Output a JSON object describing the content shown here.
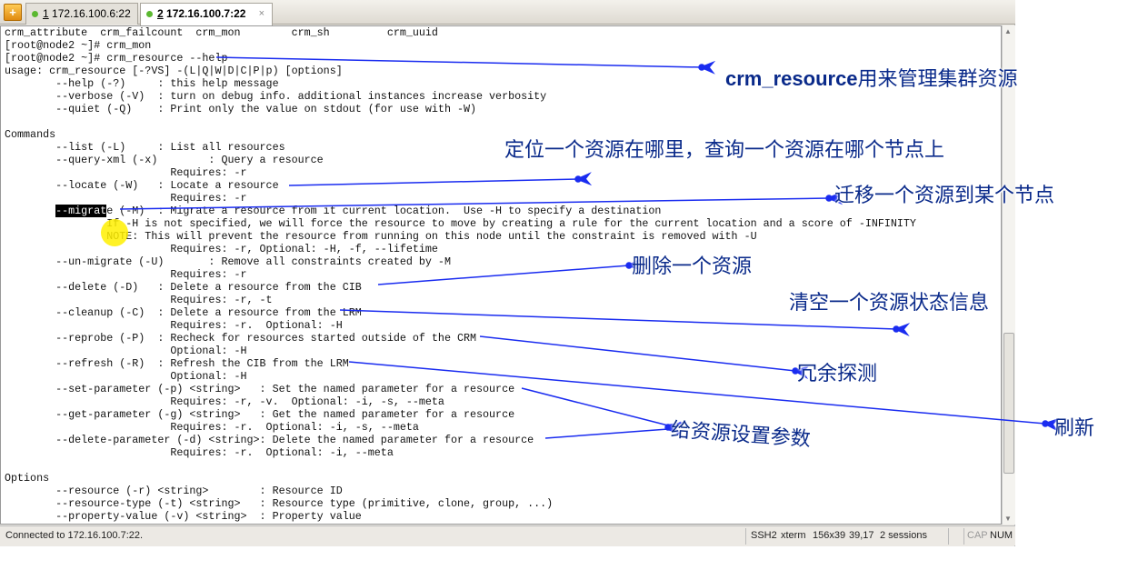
{
  "tabs": [
    {
      "num": "1",
      "label": " 172.16.100.6:22",
      "active": false
    },
    {
      "num": "2",
      "label": " 172.16.100.7:22",
      "active": true
    }
  ],
  "new_tab_icon": "+",
  "close_glyph": "×",
  "terminal": {
    "lines": [
      "crm_attribute  crm_failcount  crm_mon        crm_sh         crm_uuid",
      "[root@node2 ~]# crm_mon",
      "[root@node2 ~]# crm_resource --help",
      "usage: crm_resource [-?VS] -(L|Q|W|D|C|P|p) [options]",
      "        --help (-?)     : this help message",
      "        --verbose (-V)  : turn on debug info. additional instances increase verbosity",
      "        --quiet (-Q)    : Print only the value on stdout (for use with -W)",
      "",
      "Commands",
      "        --list (-L)     : List all resources",
      "        --query-xml (-x)        : Query a resource",
      "                          Requires: -r",
      "        --locate (-W)   : Locate a resource",
      "                          Requires: -r",
      "        --migrate (-M)  : Migrate a resource from it current location.  Use -H to specify a destination",
      "                If -H is not specified, we will force the resource to move by creating a rule for the current location and a score of -INFINITY",
      "                NOTE: This will prevent the resource from running on this node until the constraint is removed with -U",
      "                          Requires: -r, Optional: -H, -f, --lifetime",
      "        --un-migrate (-U)       : Remove all constraints created by -M",
      "                          Requires: -r",
      "        --delete (-D)   : Delete a resource from the CIB",
      "                          Requires: -r, -t",
      "        --cleanup (-C)  : Delete a resource from the LRM",
      "                          Requires: -r.  Optional: -H",
      "        --reprobe (-P)  : Recheck for resources started outside of the CRM",
      "                          Optional: -H",
      "        --refresh (-R)  : Refresh the CIB from the LRM",
      "                          Optional: -H",
      "        --set-parameter (-p) <string>   : Set the named parameter for a resource",
      "                          Requires: -r, -v.  Optional: -i, -s, --meta",
      "        --get-parameter (-g) <string>   : Get the named parameter for a resource",
      "                          Requires: -r.  Optional: -i, -s, --meta",
      "        --delete-parameter (-d) <string>: Delete the named parameter for a resource",
      "                          Requires: -r.  Optional: -i, --meta",
      "",
      "Options",
      "        --resource (-r) <string>        : Resource ID",
      "        --resource-type (-t) <string>   : Resource type (primitive, clone, group, ...)",
      "        --property-value (-v) <string>  : Property value"
    ],
    "selected_text": "--migrat"
  },
  "status": {
    "connection": "Connected to 172.16.100.7:22.",
    "protocol": "SSH2",
    "term_type": "xterm",
    "size": "156x39",
    "cursor_pos": "39,17",
    "sessions": "2 sessions",
    "cap": "CAP",
    "num": "NUM"
  },
  "annotations": {
    "manage_cmd": "crm_resource",
    "manage_rest": "用来管理集群资源",
    "locate": "定位一个资源在哪里，查询一个资源在哪个节点上",
    "migrate": "迁移一个资源到某个节点",
    "delete": "删除一个资源",
    "cleanup": "清空一个资源状态信息",
    "reprobe": "冗余探测",
    "refresh": "刷新",
    "parameter": "给资源设置参数"
  },
  "colors": {
    "arrow": "#1a2cf0",
    "annotation_text": "#0a2a8a",
    "status_dot": "#5bb830"
  }
}
